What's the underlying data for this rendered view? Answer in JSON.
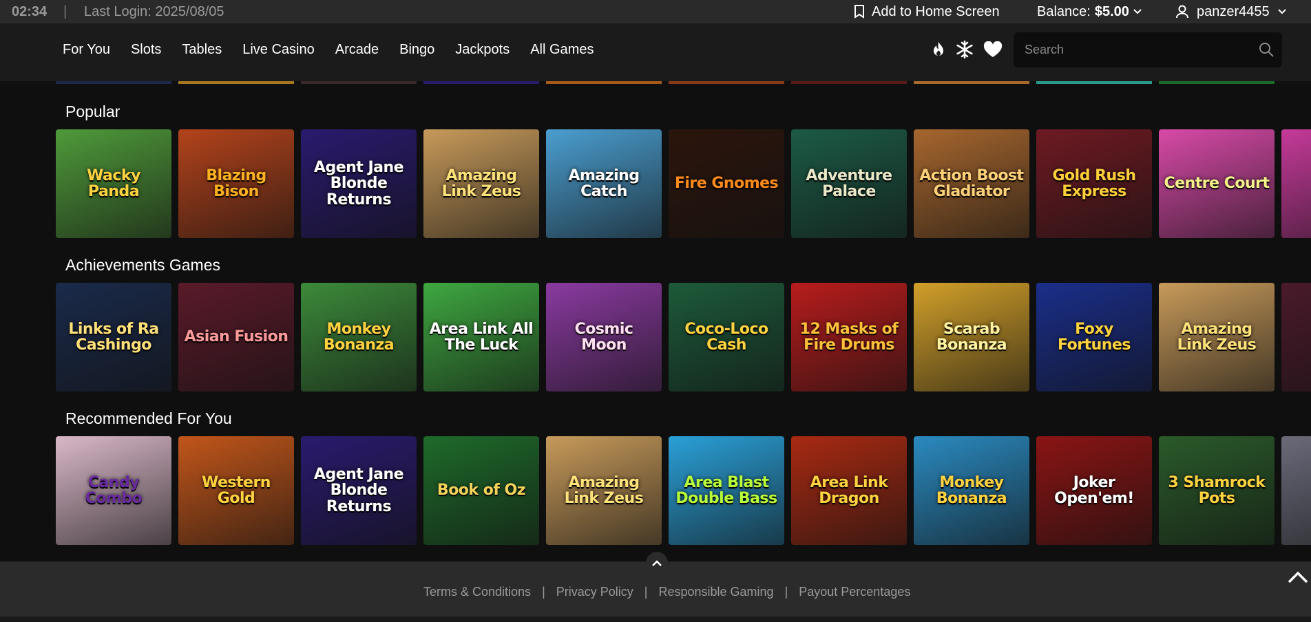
{
  "topbar": {
    "time": "02:34",
    "separator": "|",
    "last_login": "Last Login: 2025/08/05",
    "add_home": "Add to Home Screen",
    "balance_label": "Balance:",
    "balance_value": "$5.00",
    "username": "panzer4455"
  },
  "nav": {
    "items": [
      "For You",
      "Slots",
      "Tables",
      "Live Casino",
      "Arcade",
      "Bingo",
      "Jackpots",
      "All Games"
    ],
    "icons": [
      "fire-icon",
      "snowflake-icon",
      "heart-icon"
    ]
  },
  "search": {
    "placeholder": "Search"
  },
  "sections": [
    {
      "title": "Popular",
      "games": [
        {
          "name": "Wacky Panda",
          "bg": "#4f9a3a",
          "fg": "#ffd23f"
        },
        {
          "name": "Blazing Bison",
          "bg": "#b3431b",
          "fg": "#ffb21f"
        },
        {
          "name": "Agent Jane Blonde Returns",
          "bg": "#2a1a6e",
          "fg": "#ffffff"
        },
        {
          "name": "Amazing Link Zeus",
          "bg": "#c79a5a",
          "fg": "#ffe27a"
        },
        {
          "name": "Amazing Catch",
          "bg": "#4a9ed0",
          "fg": "#ffffff"
        },
        {
          "name": "Fire Gnomes",
          "bg": "#2b150c",
          "fg": "#ff8a1a"
        },
        {
          "name": "Adventure Palace",
          "bg": "#1c5a46",
          "fg": "#e8e8c8"
        },
        {
          "name": "Action Boost Gladiator",
          "bg": "#a6662e",
          "fg": "#ffd27a"
        },
        {
          "name": "Gold Rush Express",
          "bg": "#6e1a22",
          "fg": "#ffcf3a"
        },
        {
          "name": "Centre Court",
          "bg": "#d84aa8",
          "fg": "#f4f08a"
        },
        {
          "name": "",
          "bg": "#c63a9a",
          "fg": "#ffffff"
        }
      ]
    },
    {
      "title": "Achievements Games",
      "games": [
        {
          "name": "Links of Ra Cashingo",
          "bg": "#1a2a4a",
          "fg": "#ffe07a"
        },
        {
          "name": "Asian Fusion",
          "bg": "#5a1a2a",
          "fg": "#ff9a9a"
        },
        {
          "name": "Monkey Bonanza",
          "bg": "#3c8a3a",
          "fg": "#ffd23f"
        },
        {
          "name": "Area Link All The Luck",
          "bg": "#3ea840",
          "fg": "#ffffff"
        },
        {
          "name": "Cosmic Moon",
          "bg": "#8a3aa0",
          "fg": "#ffe0f0"
        },
        {
          "name": "Coco-Loco Cash",
          "bg": "#1d5a3a",
          "fg": "#ffd23f"
        },
        {
          "name": "12 Masks of Fire Drums",
          "bg": "#b81c1c",
          "fg": "#ffc03a"
        },
        {
          "name": "Scarab Bonanza",
          "bg": "#d2a02a",
          "fg": "#fff2a0"
        },
        {
          "name": "Foxy Fortunes",
          "bg": "#1a2e8a",
          "fg": "#ffd23f"
        },
        {
          "name": "Amazing Link Zeus",
          "bg": "#c79a5a",
          "fg": "#ffe27a"
        },
        {
          "name": "",
          "bg": "#4a1a2a",
          "fg": "#ffffff"
        }
      ]
    },
    {
      "title": "Recommended For You",
      "games": [
        {
          "name": "Candy Combo",
          "bg": "#d9b8c8",
          "fg": "#6a2aa0"
        },
        {
          "name": "Western Gold",
          "bg": "#c2561a",
          "fg": "#ffd23f"
        },
        {
          "name": "Agent Jane Blonde Returns",
          "bg": "#2a1a6e",
          "fg": "#ffffff"
        },
        {
          "name": "Book of Oz",
          "bg": "#1e6a2a",
          "fg": "#f2d25a"
        },
        {
          "name": "Amazing Link Zeus",
          "bg": "#c79a5a",
          "fg": "#ffe27a"
        },
        {
          "name": "Area Blast Double Bass",
          "bg": "#2aa0d8",
          "fg": "#b8ff3a"
        },
        {
          "name": "Area Link Dragon",
          "bg": "#a82a12",
          "fg": "#ffd23f"
        },
        {
          "name": "Monkey Bonanza",
          "bg": "#2a8ac0",
          "fg": "#ffd23f"
        },
        {
          "name": "Joker Open'em!",
          "bg": "#8a1414",
          "fg": "#ffffff"
        },
        {
          "name": "3 Shamrock Pots",
          "bg": "#2a5a2a",
          "fg": "#ffd23f"
        },
        {
          "name": "",
          "bg": "#6a6a7a",
          "fg": "#ffffff"
        }
      ]
    }
  ],
  "peek_colors": [
    "#1b2a4a",
    "#a8781e",
    "#3a2a2a",
    "#2a1a6a",
    "#a85a1a",
    "#8a3a1a",
    "#5a1a1a",
    "#a86a2a",
    "#2a9a8a",
    "#1a6a2a"
  ],
  "footer": {
    "links": [
      "Terms & Conditions",
      "Privacy Policy",
      "Responsible Gaming",
      "Payout Percentages"
    ],
    "separator": "|"
  }
}
